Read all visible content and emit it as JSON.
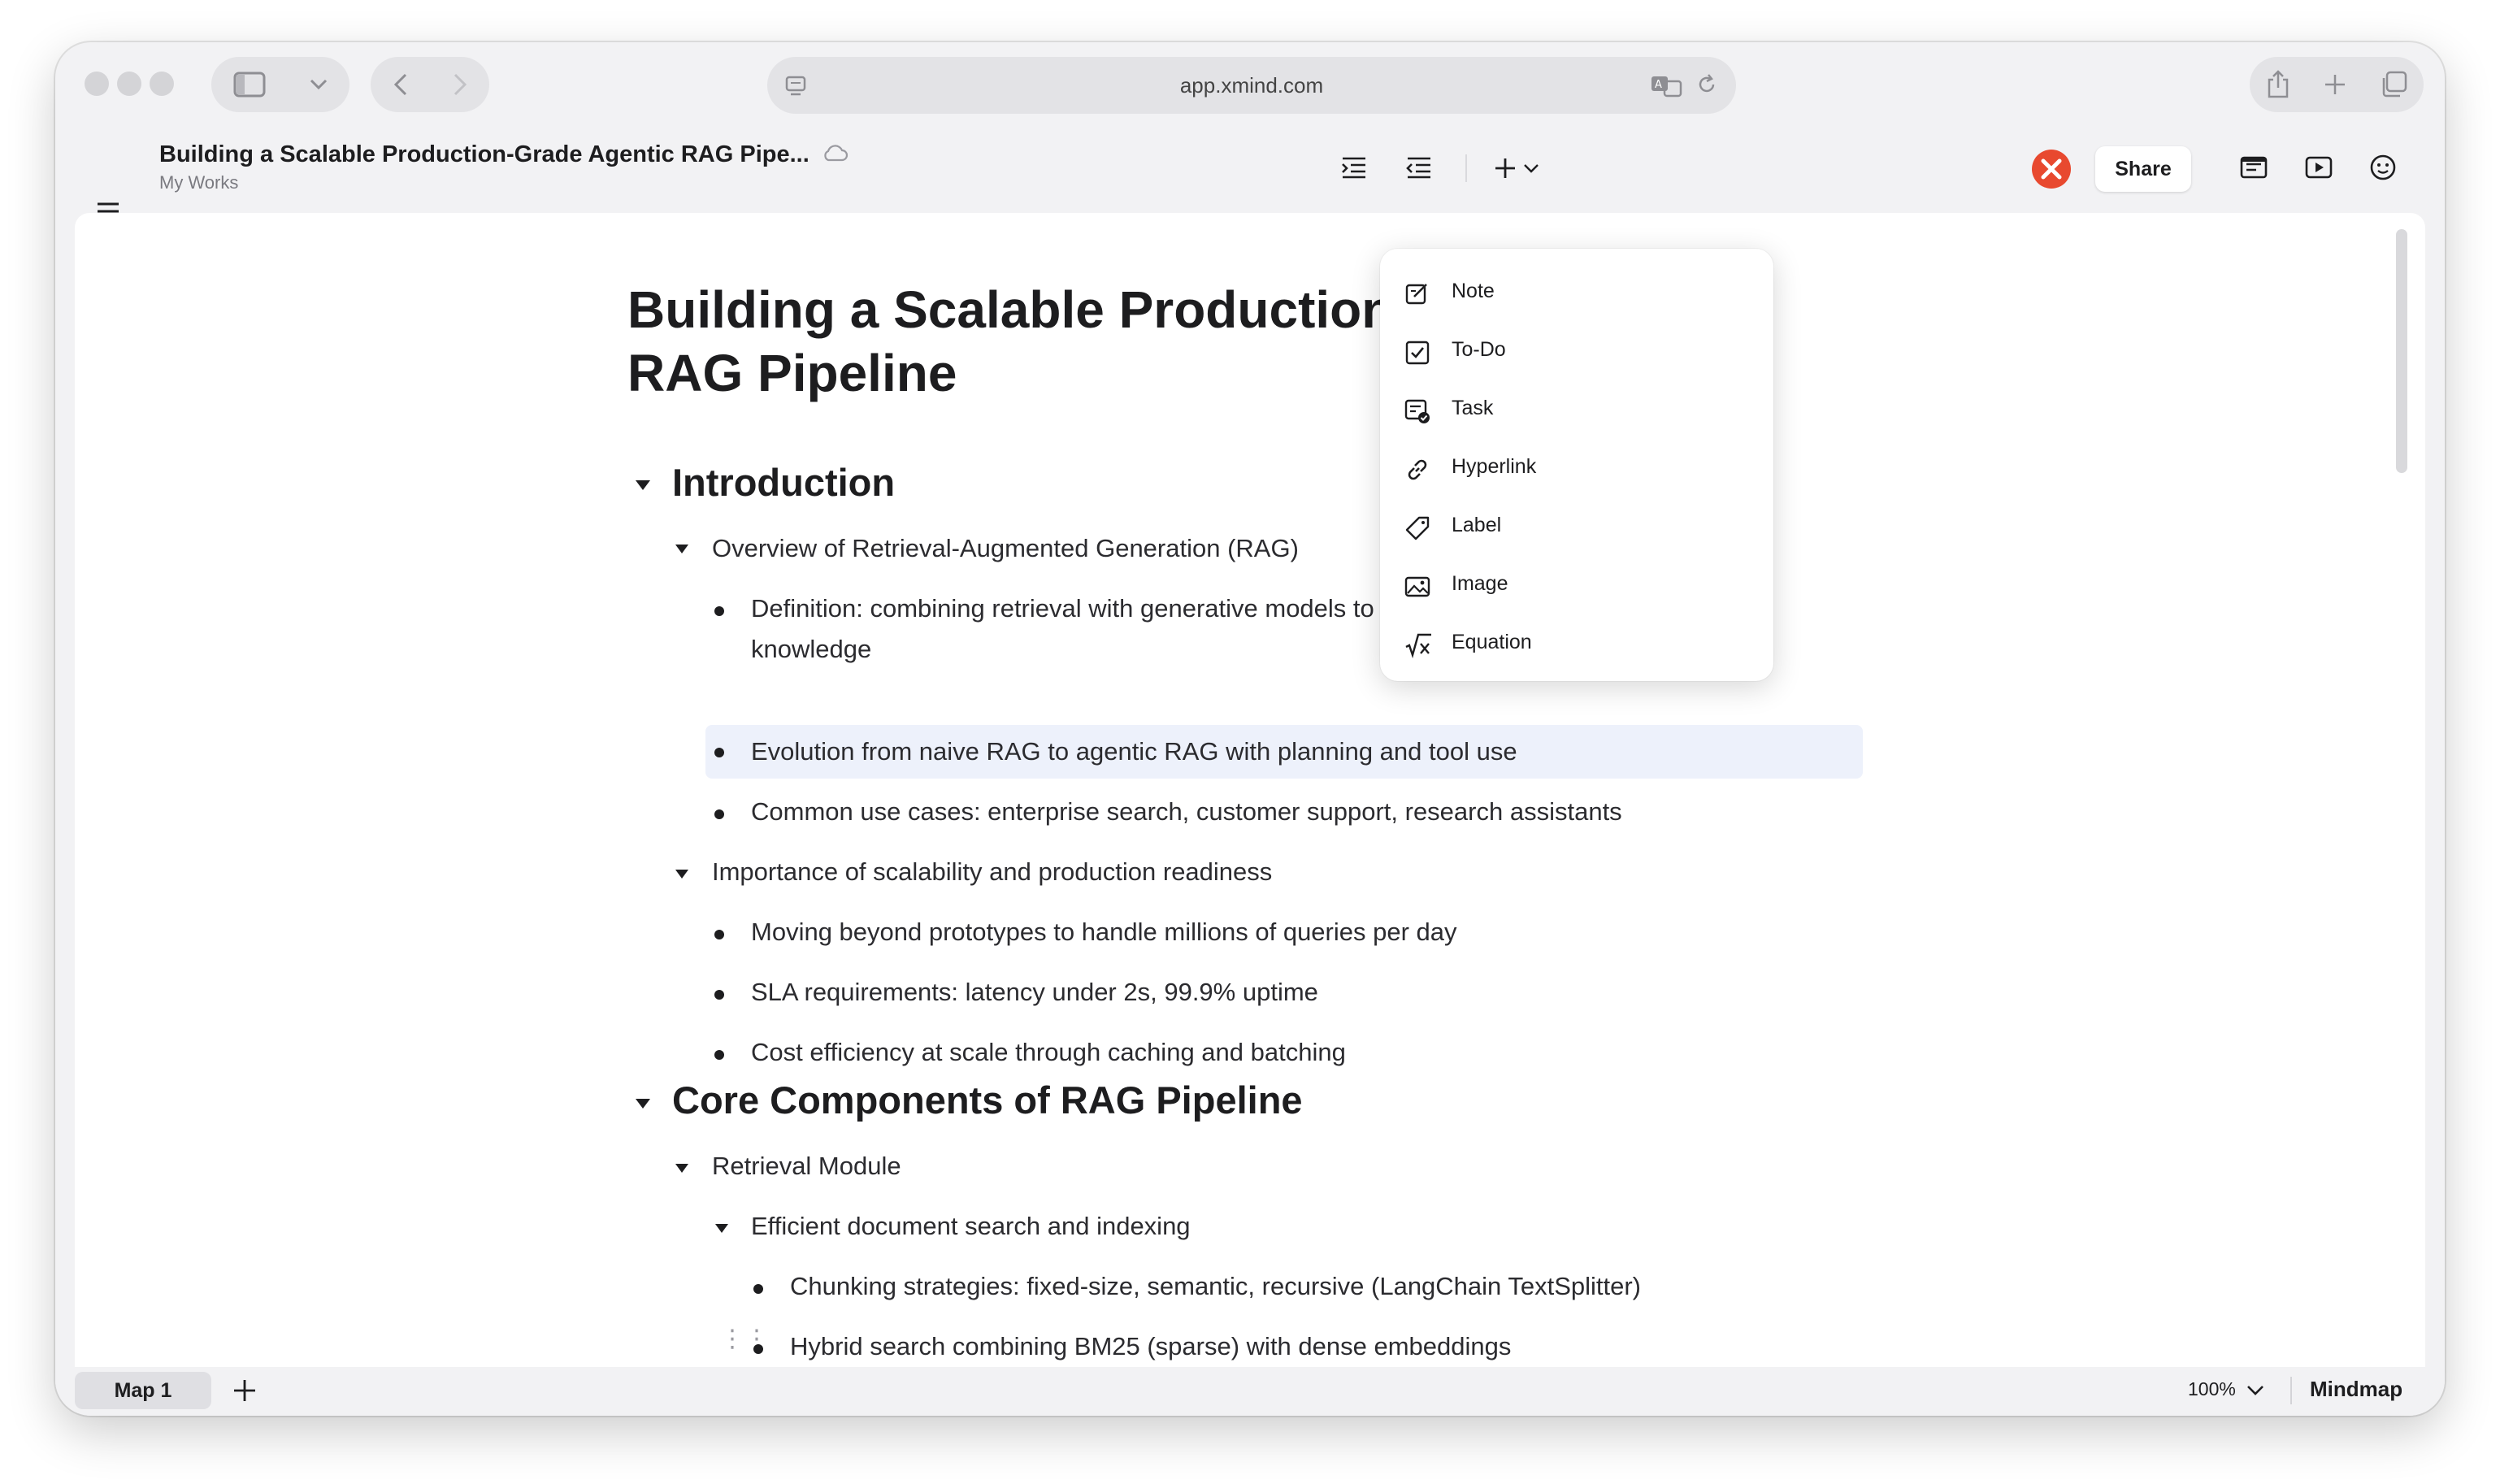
{
  "browser": {
    "url": "app.xmind.com"
  },
  "header": {
    "doc_title": "Building a Scalable Production-Grade Agentic RAG Pipe...",
    "breadcrumb": "My Works",
    "share_label": "Share"
  },
  "document": {
    "title": "Building a Scalable Production-Grade Agentic RAG Pipeline",
    "sections": [
      {
        "heading": "Introduction",
        "items": [
          "Overview of Retrieval-Augmented Generation (RAG)",
          "Definition: combining retrieval with generative models to ground responses in external",
          "knowledge",
          "Evolution from naive RAG to agentic RAG with planning and tool use",
          "Common use cases: enterprise search, customer support, research assistants",
          "Importance of scalability and production readiness",
          "Moving beyond prototypes to handle millions of queries per day",
          "SLA requirements: latency under 2s, 99.9% uptime",
          "Cost efficiency at scale through caching and batching"
        ]
      },
      {
        "heading": "Core Components of RAG Pipeline",
        "items": [
          "Retrieval Module",
          "Efficient document search and indexing",
          "Chunking strategies: fixed-size, semantic, recursive (LangChain TextSplitter)",
          "Hybrid search combining BM25 (sparse) with dense embeddings"
        ]
      }
    ]
  },
  "insert_menu": {
    "items": [
      {
        "label": "Note",
        "icon": "note-icon"
      },
      {
        "label": "To-Do",
        "icon": "checkbox-icon"
      },
      {
        "label": "Task",
        "icon": "task-icon"
      },
      {
        "label": "Hyperlink",
        "icon": "link-icon"
      },
      {
        "label": "Label",
        "icon": "tag-icon"
      },
      {
        "label": "Image",
        "icon": "image-icon"
      },
      {
        "label": "Equation",
        "icon": "sqrt-icon"
      }
    ]
  },
  "footer": {
    "sheet_tab": "Map 1",
    "zoom": "100%",
    "view_mode": "Mindmap"
  },
  "colors": {
    "accent_logo": "#e8492f",
    "selection_highlight": "#edf1fb"
  }
}
